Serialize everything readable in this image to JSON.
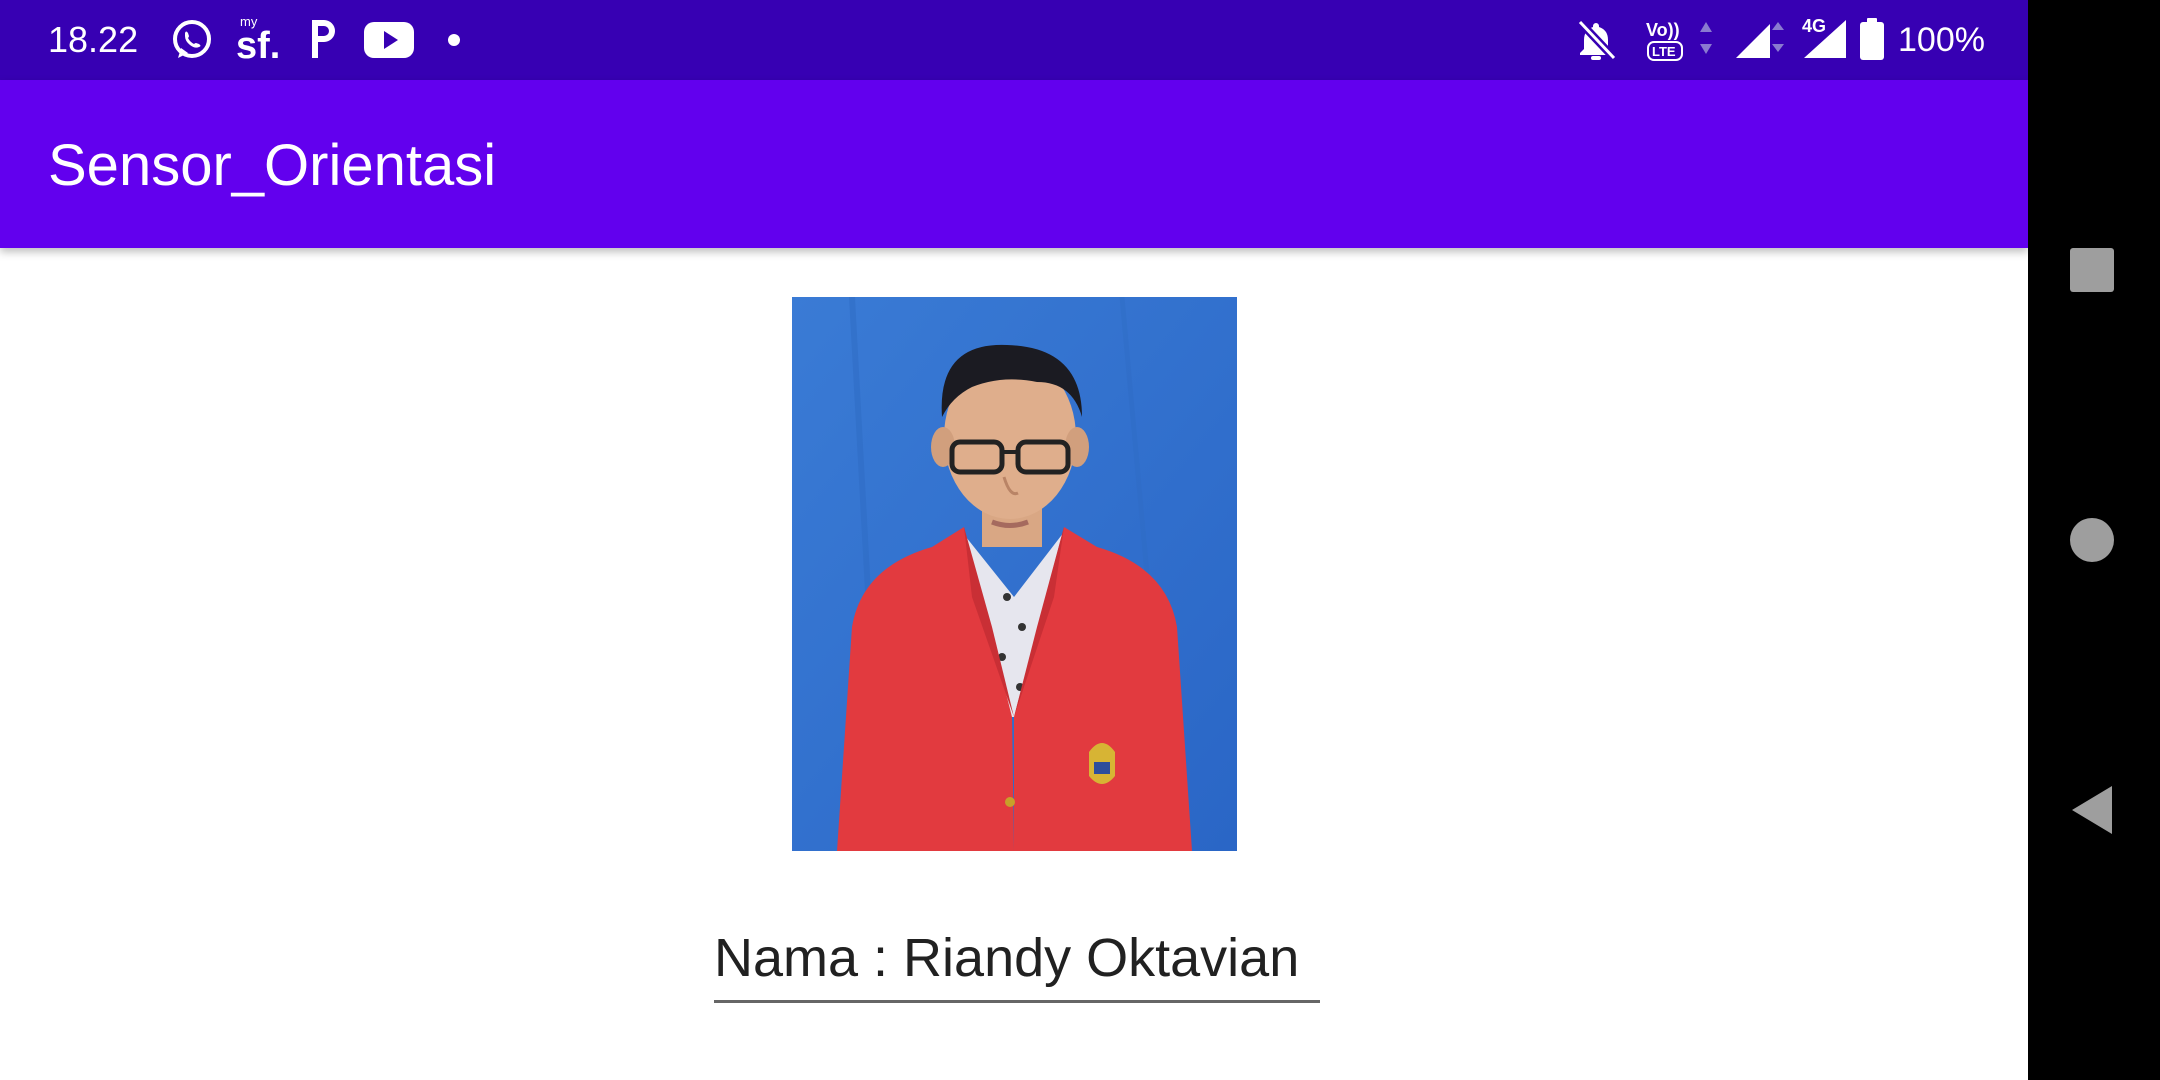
{
  "status_bar": {
    "time": "18.22",
    "sf_label": "sf.",
    "sf_sup": "my",
    "volte_label": "Vo))",
    "lte_label": "LTE",
    "network_label": "4G",
    "battery_percent": "100%",
    "icons": [
      "whatsapp-icon",
      "mysf-icon",
      "pinterest-icon",
      "youtube-icon",
      "notification-dot-icon",
      "bell-off-icon",
      "volte-icon",
      "signal-icon",
      "signal-4g-icon",
      "battery-icon"
    ]
  },
  "app_bar": {
    "title": "Sensor_Orientasi"
  },
  "main": {
    "photo_description": "profile-photo",
    "name_text": "Nama : Riandy Oktavian"
  },
  "nav_bar": {
    "icons": [
      "recents-icon",
      "home-icon",
      "back-icon"
    ]
  },
  "colors": {
    "status_bar": "#3700B3",
    "app_bar": "#6200EE",
    "nav_bar": "#000000"
  }
}
